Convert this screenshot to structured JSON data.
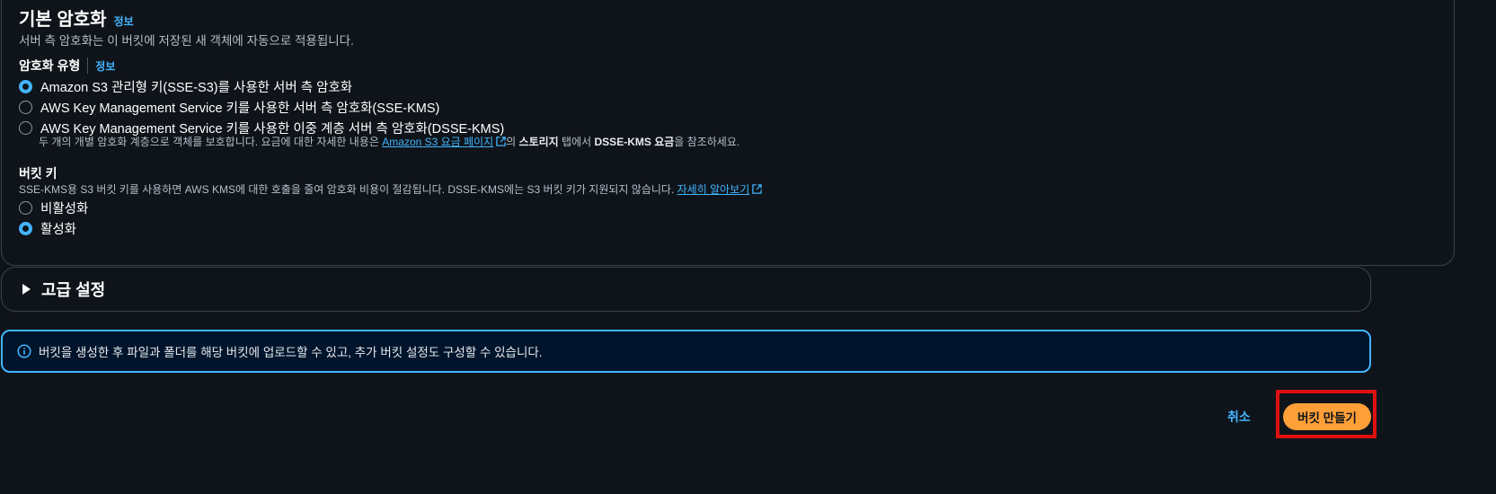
{
  "encryption": {
    "title": "기본 암호화",
    "info_link": "정보",
    "description": "서버 측 암호화는 이 버킷에 저장된 새 객체에 자동으로 적용됩니다.",
    "type_label": "암호화 유형",
    "type_info_link": "정보",
    "options": [
      {
        "label": "Amazon S3 관리형 키(SSE-S3)를 사용한 서버 측 암호화",
        "checked": true
      },
      {
        "label": "AWS Key Management Service 키를 사용한 서버 측 암호화(SSE-KMS)",
        "checked": false
      },
      {
        "label": "AWS Key Management Service 키를 사용한 이중 계층 서버 측 암호화(DSSE-KMS)",
        "checked": false
      }
    ],
    "dsse_desc_prefix": "두 개의 개별 암호화 계층으로 객체를 보호합니다. 요금에 대한 자세한 내용은 ",
    "dsse_desc_link": "Amazon S3 요금 페이지",
    "dsse_desc_mid": "의 ",
    "dsse_desc_bold1": "스토리지",
    "dsse_desc_mid2": " 탭에서 ",
    "dsse_desc_bold2": "DSSE-KMS 요금",
    "dsse_desc_suffix": "을 참조하세요."
  },
  "bucket_key": {
    "label": "버킷 키",
    "description": "SSE-KMS용 S3 버킷 키를 사용하면 AWS KMS에 대한 호출을 줄여 암호화 비용이 절감됩니다. DSSE-KMS에는 S3 버킷 키가 지원되지 않습니다. ",
    "learn_more": "자세히 알아보기",
    "options": [
      {
        "label": "비활성화",
        "checked": false
      },
      {
        "label": "활성화",
        "checked": true
      }
    ]
  },
  "advanced": {
    "label": "고급 설정"
  },
  "alert": {
    "text": "버킷을 생성한 후 파일과 폴더를 해당 버킷에 업로드할 수 있고, 추가 버킷 설정도 구성할 수 있습니다."
  },
  "footer": {
    "cancel_label": "취소",
    "create_label": "버킷 만들기"
  },
  "colors": {
    "accent": "#42b4ff",
    "primary_button": "#ff9f38",
    "highlight_box": "#e01010"
  }
}
